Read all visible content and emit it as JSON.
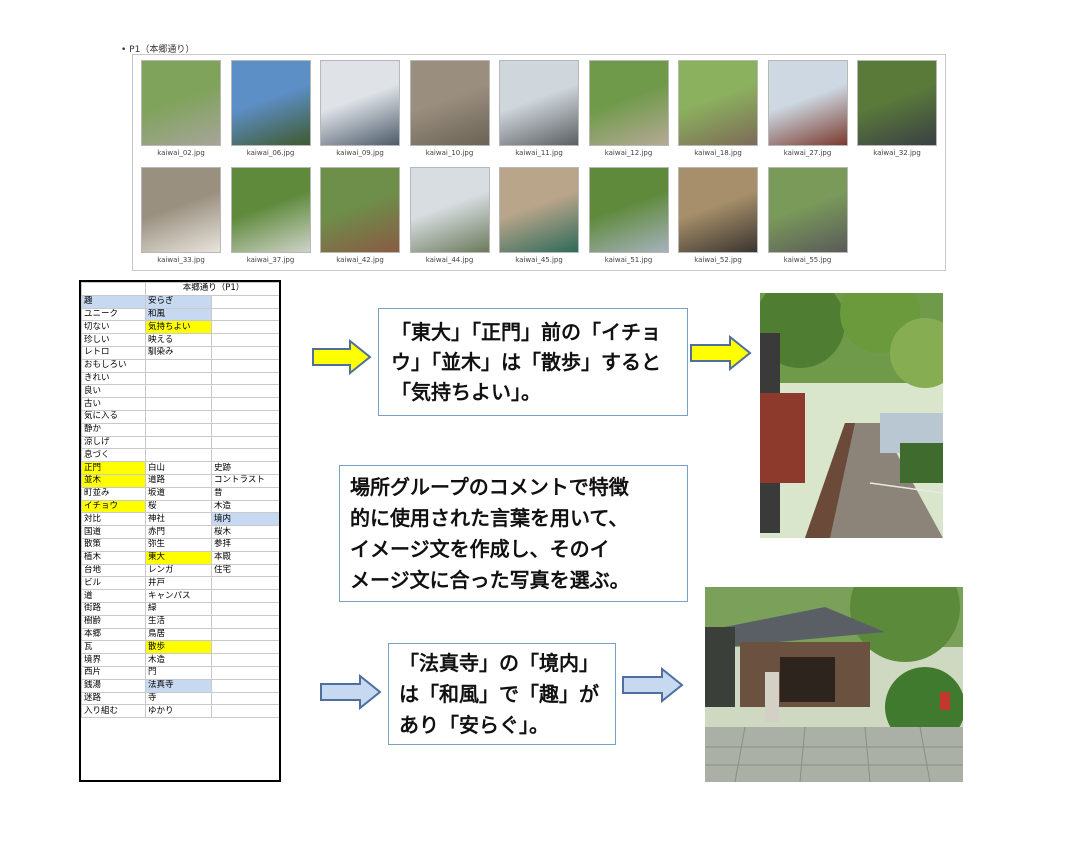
{
  "gallery": {
    "bullet": "• P1（本郷通り）",
    "thumbnails": [
      {
        "filename": "kaiwai_02.jpg"
      },
      {
        "filename": "kaiwai_06.jpg"
      },
      {
        "filename": "kaiwai_09.jpg"
      },
      {
        "filename": "kaiwai_10.jpg"
      },
      {
        "filename": "kaiwai_11.jpg"
      },
      {
        "filename": "kaiwai_12.jpg"
      },
      {
        "filename": "kaiwai_18.jpg"
      },
      {
        "filename": "kaiwai_27.jpg"
      },
      {
        "filename": "kaiwai_32.jpg"
      },
      {
        "filename": "kaiwai_33.jpg"
      },
      {
        "filename": "kaiwai_37.jpg"
      },
      {
        "filename": "kaiwai_42.jpg"
      },
      {
        "filename": "kaiwai_44.jpg"
      },
      {
        "filename": "kaiwai_45.jpg"
      },
      {
        "filename": "kaiwai_51.jpg"
      },
      {
        "filename": "kaiwai_52.jpg"
      },
      {
        "filename": "kaiwai_55.jpg"
      }
    ]
  },
  "word_table": {
    "header": "本郷通り（P1）",
    "rows": [
      [
        {
          "t": "趣",
          "c": "b"
        },
        {
          "t": "安らぎ",
          "c": "b"
        },
        {
          "t": ""
        }
      ],
      [
        {
          "t": "ユニーク"
        },
        {
          "t": "和風",
          "c": "b"
        },
        {
          "t": ""
        }
      ],
      [
        {
          "t": "切ない"
        },
        {
          "t": "気持ちよい",
          "c": "y"
        },
        {
          "t": ""
        }
      ],
      [
        {
          "t": "珍しい"
        },
        {
          "t": "映える"
        },
        {
          "t": ""
        }
      ],
      [
        {
          "t": "レトロ"
        },
        {
          "t": "馴染み"
        },
        {
          "t": ""
        }
      ],
      [
        {
          "t": "おもしろい"
        },
        {
          "t": ""
        },
        {
          "t": ""
        }
      ],
      [
        {
          "t": "きれい"
        },
        {
          "t": ""
        },
        {
          "t": ""
        }
      ],
      [
        {
          "t": "良い"
        },
        {
          "t": ""
        },
        {
          "t": ""
        }
      ],
      [
        {
          "t": "古い"
        },
        {
          "t": ""
        },
        {
          "t": ""
        }
      ],
      [
        {
          "t": "気に入る"
        },
        {
          "t": ""
        },
        {
          "t": ""
        }
      ],
      [
        {
          "t": "静か"
        },
        {
          "t": ""
        },
        {
          "t": ""
        }
      ],
      [
        {
          "t": "涼しげ"
        },
        {
          "t": ""
        },
        {
          "t": ""
        }
      ],
      [
        {
          "t": "息づく"
        },
        {
          "t": ""
        },
        {
          "t": ""
        }
      ],
      [
        {
          "t": "正門",
          "c": "y"
        },
        {
          "t": "白山"
        },
        {
          "t": "史跡"
        }
      ],
      [
        {
          "t": "並木",
          "c": "y"
        },
        {
          "t": "道路"
        },
        {
          "t": "コントラスト"
        }
      ],
      [
        {
          "t": "町並み"
        },
        {
          "t": "坂道"
        },
        {
          "t": "昔"
        }
      ],
      [
        {
          "t": "イチョウ",
          "c": "y"
        },
        {
          "t": "桜"
        },
        {
          "t": "木造"
        }
      ],
      [
        {
          "t": "対比"
        },
        {
          "t": "神社"
        },
        {
          "t": "境内",
          "c": "b"
        }
      ],
      [
        {
          "t": "国道"
        },
        {
          "t": "赤門"
        },
        {
          "t": "桜木"
        }
      ],
      [
        {
          "t": "散策"
        },
        {
          "t": "弥生"
        },
        {
          "t": "参拝"
        }
      ],
      [
        {
          "t": "植木"
        },
        {
          "t": "東大",
          "c": "y"
        },
        {
          "t": "本殿"
        }
      ],
      [
        {
          "t": "台地"
        },
        {
          "t": "レンガ"
        },
        {
          "t": "住宅"
        }
      ],
      [
        {
          "t": "ビル"
        },
        {
          "t": "井戸"
        },
        {
          "t": ""
        }
      ],
      [
        {
          "t": "道"
        },
        {
          "t": "キャンパス"
        },
        {
          "t": ""
        }
      ],
      [
        {
          "t": "街路"
        },
        {
          "t": "緑"
        },
        {
          "t": ""
        }
      ],
      [
        {
          "t": "樹齢"
        },
        {
          "t": "生活"
        },
        {
          "t": ""
        }
      ],
      [
        {
          "t": "本郷"
        },
        {
          "t": "鳥居"
        },
        {
          "t": ""
        }
      ],
      [
        {
          "t": "瓦"
        },
        {
          "t": "散歩",
          "c": "y"
        },
        {
          "t": ""
        }
      ],
      [
        {
          "t": "境界"
        },
        {
          "t": "木造"
        },
        {
          "t": ""
        }
      ],
      [
        {
          "t": "西片"
        },
        {
          "t": "門"
        },
        {
          "t": ""
        }
      ],
      [
        {
          "t": "銭湯"
        },
        {
          "t": "法真寺",
          "c": "b"
        },
        {
          "t": ""
        }
      ],
      [
        {
          "t": "迷路"
        },
        {
          "t": "寺"
        },
        {
          "t": ""
        }
      ],
      [
        {
          "t": "入り組む"
        },
        {
          "t": "ゆかり"
        },
        {
          "t": ""
        }
      ]
    ]
  },
  "text_boxes": {
    "top": [
      "「東大」「正門」前の「イチョ",
      "ウ」「並木」は「散歩」すると",
      "「気持ちよい」。"
    ],
    "middle": [
      "場所グループのコメントで特徴",
      "的に使用された言葉を用いて、",
      "イメージ文を作成し、そのイ",
      "メージ文に合った写真を選ぶ。"
    ],
    "bottom": [
      "「法真寺」の「境内」",
      "は「和風」で「趣」が",
      "あり「安らぐ」。"
    ]
  },
  "colors": {
    "yellow_arrow": "#ffff00",
    "blue_arrow": "#c6d9f1",
    "arrow_border": "#4f6fa0",
    "highlight_yellow": "#ffff00",
    "highlight_blue": "#c6d9f1",
    "box_border": "#7aa0c8"
  }
}
